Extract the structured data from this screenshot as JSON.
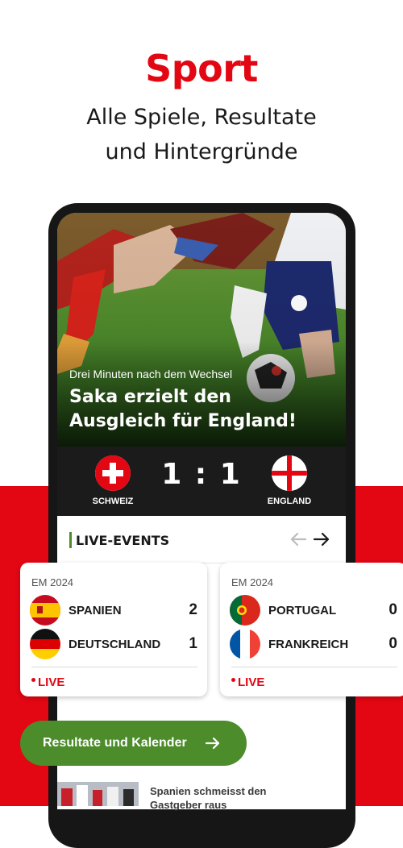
{
  "header": {
    "title": "Sport",
    "subtitle_line1": "Alle Spiele, Resultate",
    "subtitle_line2": "und Hintergründe"
  },
  "hero": {
    "kicker": "Drei Minuten nach dem Wechsel",
    "title_line1": "Saka erzielt den",
    "title_line2": "Ausgleich für England!"
  },
  "match": {
    "home_team": "SCHWEIZ",
    "away_team": "ENGLAND",
    "score": "1 : 1"
  },
  "live_events": {
    "title": "LIVE-EVENTS",
    "cards": [
      {
        "league": "EM 2024",
        "team1": "SPANIEN",
        "score1": "2",
        "team2": "DEUTSCHLAND",
        "score2": "1",
        "status": "LIVE"
      },
      {
        "league": "EM 2024",
        "team1": "PORTUGAL",
        "score1": "0",
        "team2": "FRANKREICH",
        "score2": "0",
        "status": "LIVE"
      }
    ]
  },
  "cta": {
    "label": "Resultate und Kalender"
  },
  "news": {
    "headline": "Spanien schmeisst den Gastgeber raus"
  },
  "colors": {
    "brand_red": "#e30613",
    "accent_green": "#4c8c2b",
    "dark": "#1b1b1b"
  },
  "icons": [
    "arrow-left-icon",
    "arrow-right-icon",
    "live-dot-icon",
    "cta-arrow-icon"
  ]
}
